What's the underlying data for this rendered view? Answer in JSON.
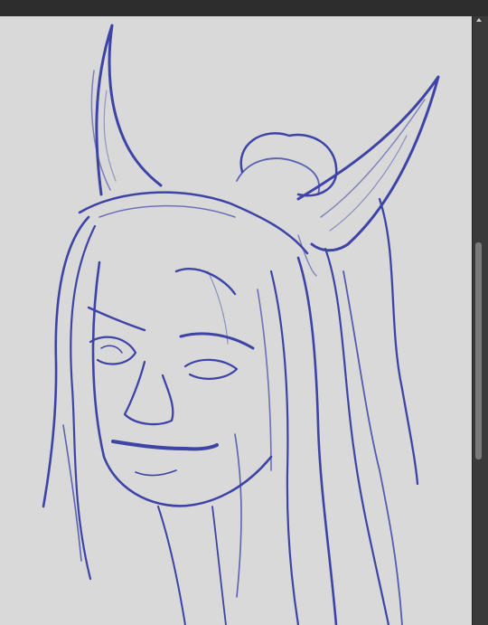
{
  "app": {
    "canvas_background": "#d9d9d9",
    "stroke_color": "#3d44a6",
    "chrome_color": "#2b2b2b"
  },
  "canvas": {
    "content": "sketch-of-elf-portrait"
  },
  "scrollbar": {
    "orientation": "vertical",
    "position_fraction": 0.41
  },
  "icons": {
    "scroll_up": "chevron-up-icon"
  }
}
